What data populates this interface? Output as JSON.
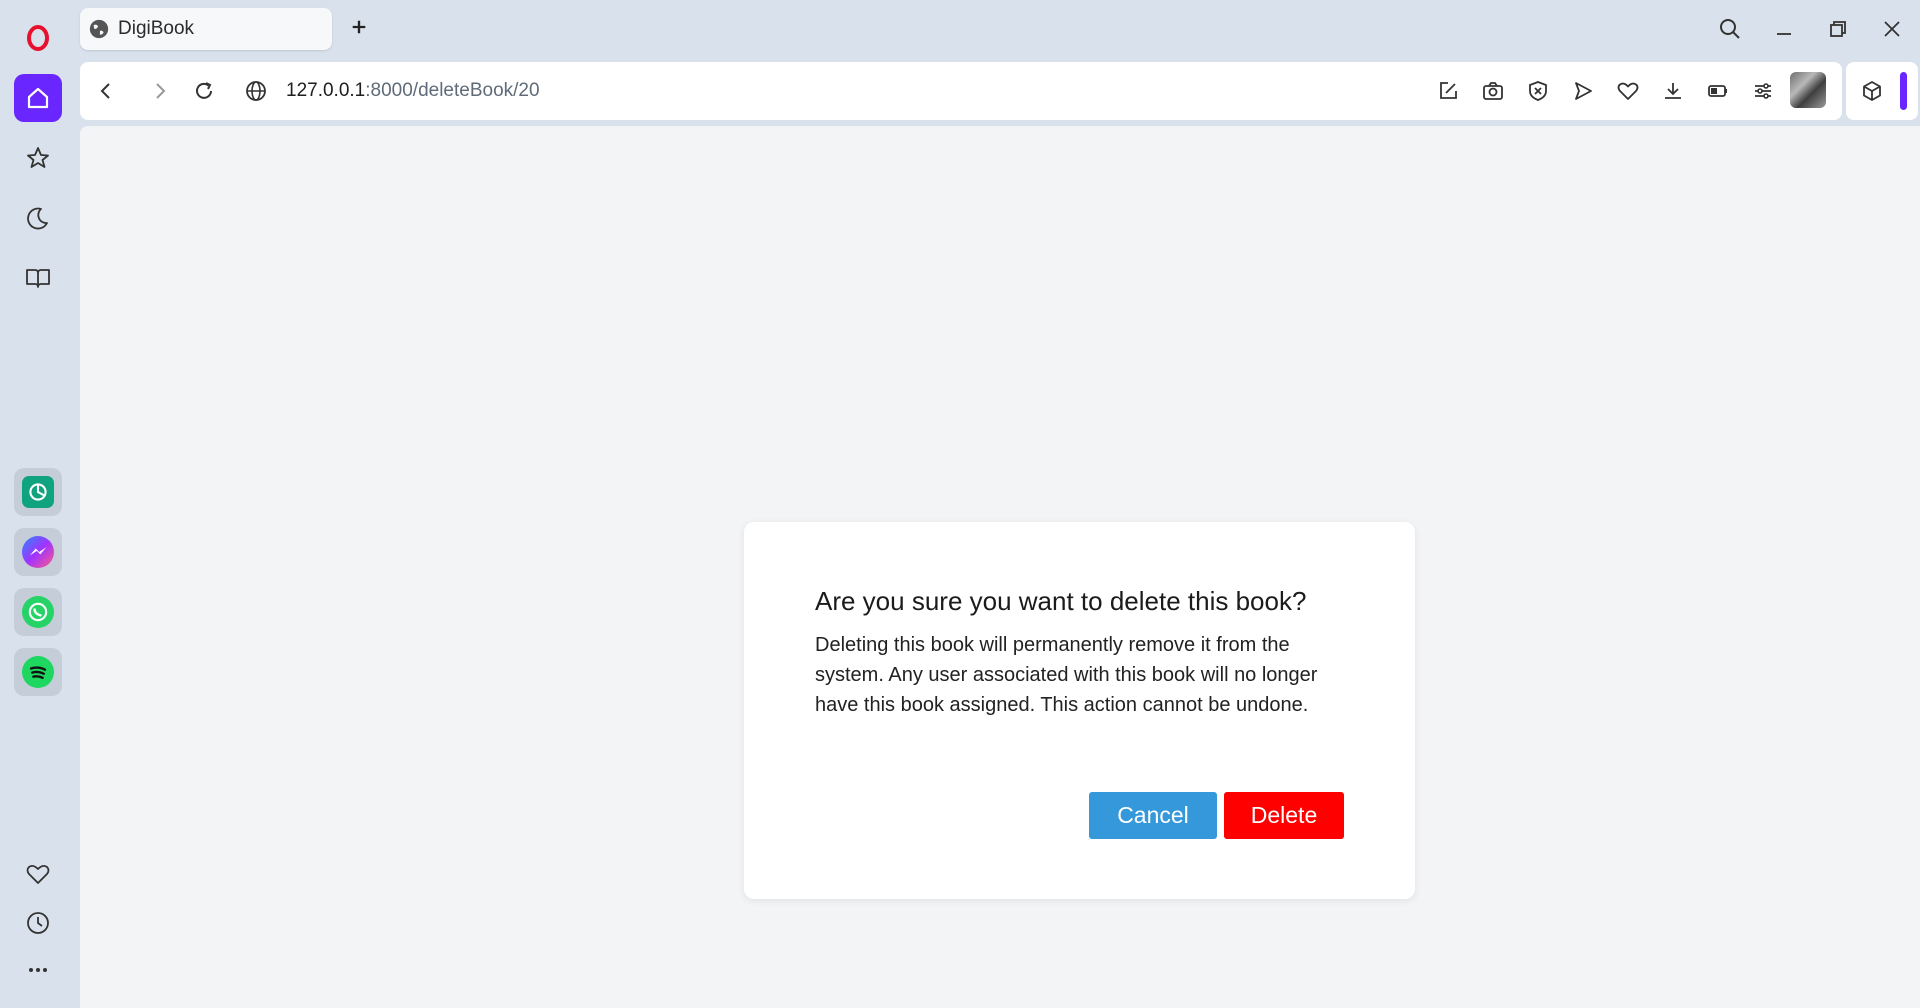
{
  "browser": {
    "tab": {
      "title": "DigiBook"
    },
    "address": {
      "host": "127.0.0.1",
      "path": ":8000/deleteBook/20"
    },
    "accent_color": "#6a26ff"
  },
  "sidebar": {
    "items": [
      {
        "name": "home",
        "icon": "home-icon",
        "active": true
      },
      {
        "name": "bookmarks",
        "icon": "star-icon"
      },
      {
        "name": "history",
        "icon": "moon-icon"
      },
      {
        "name": "reading-list",
        "icon": "book-icon"
      }
    ],
    "apps": [
      {
        "name": "chatgpt",
        "icon": "chatgpt-icon"
      },
      {
        "name": "messenger",
        "icon": "messenger-icon"
      },
      {
        "name": "whatsapp",
        "icon": "whatsapp-icon"
      },
      {
        "name": "spotify",
        "icon": "spotify-icon"
      }
    ]
  },
  "dialog": {
    "title": "Are you sure you want to delete this book?",
    "message": "Deleting this book will permanently remove it from the system. Any user associated with this book will no longer have this book assigned. This action cannot be undone.",
    "cancel_label": "Cancel",
    "delete_label": "Delete",
    "cancel_color": "#3498db",
    "delete_color": "#ff0000"
  }
}
